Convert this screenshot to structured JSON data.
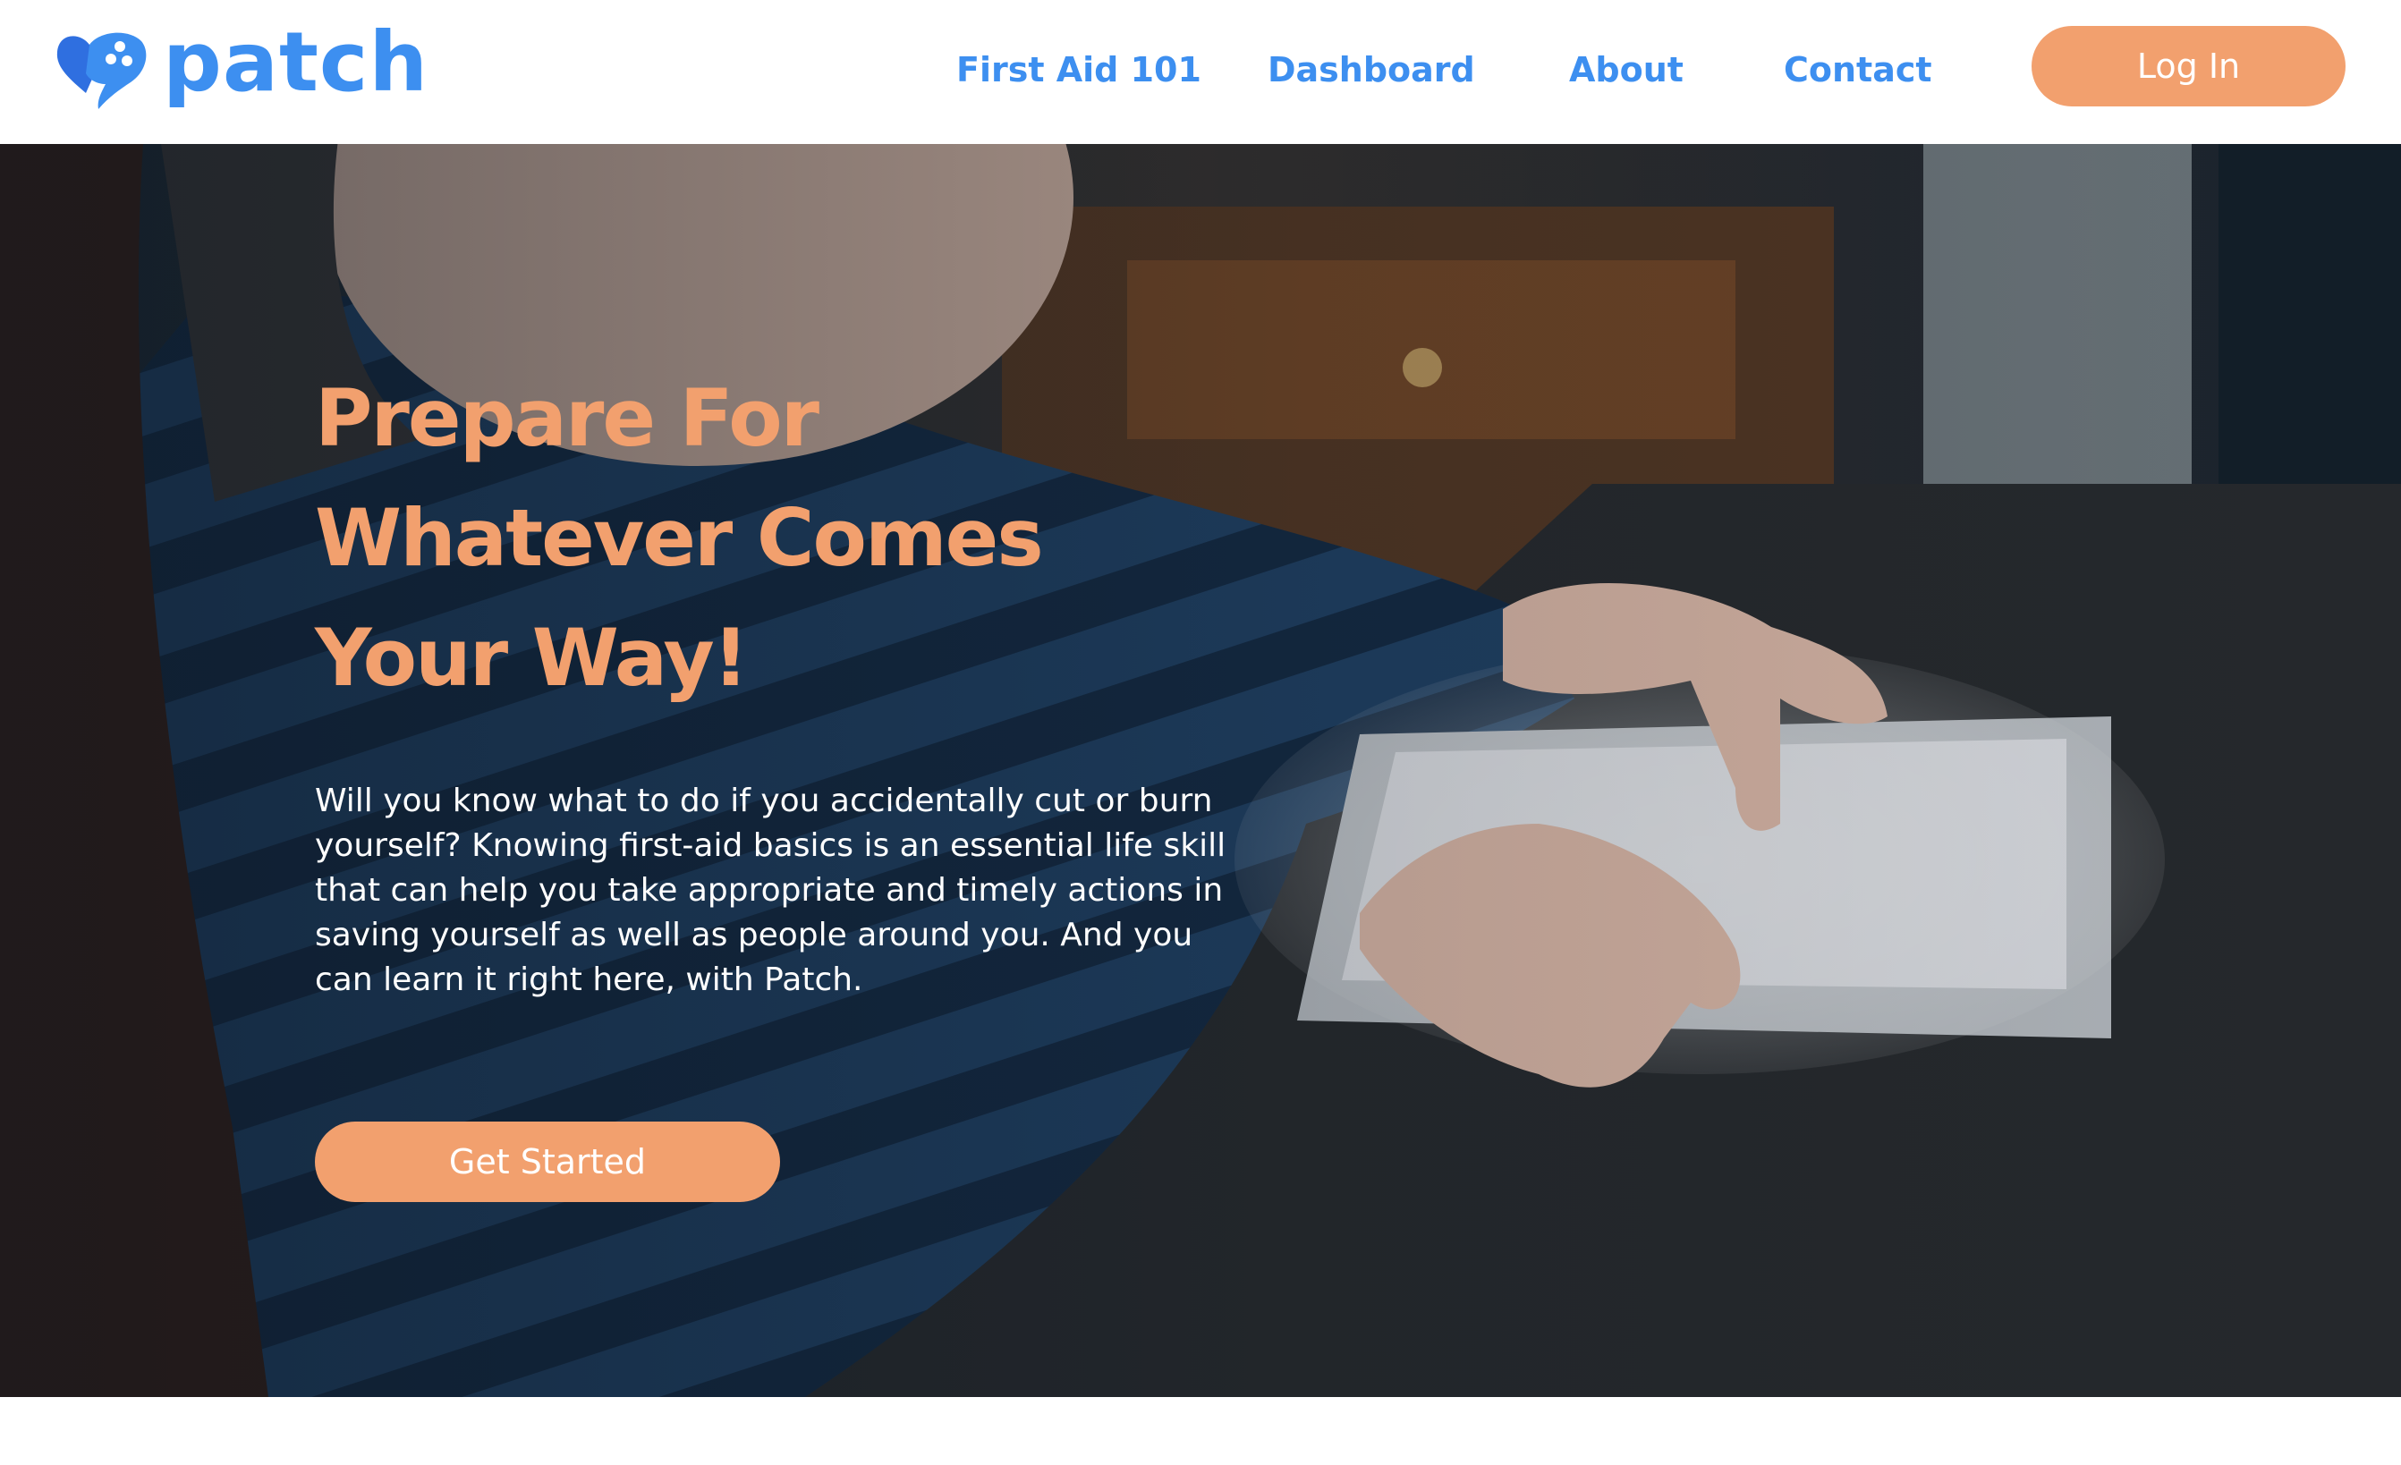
{
  "brand": {
    "name": "patch",
    "logo_icon": "heart-bandage-icon",
    "primary_color": "#3d8ff0",
    "accent_color": "#f2a06e"
  },
  "nav": {
    "items": [
      {
        "label": "First Aid 101"
      },
      {
        "label": "Dashboard"
      },
      {
        "label": "About"
      },
      {
        "label": "Contact"
      }
    ],
    "login_label": "Log In"
  },
  "hero": {
    "headline_lines": [
      "Prepare For",
      "Whatever Comes",
      "Your Way!"
    ],
    "body": "Will you know what to do if you accidentally cut or burn yourself? Knowing first-aid basics is an essential life skill that can help you take appropriate and timely actions in saving yourself as well as people around you. And you can learn it right here, with Patch.",
    "cta_label": "Get Started"
  }
}
